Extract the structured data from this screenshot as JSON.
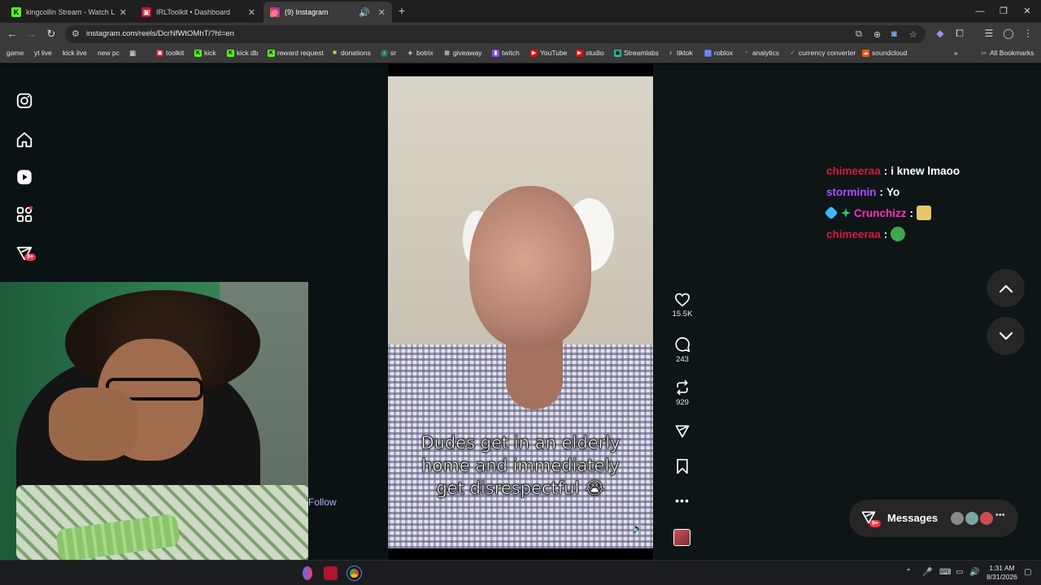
{
  "browser": {
    "tabs": [
      {
        "title": "kingcollin Stream - Watch Live",
        "active": false
      },
      {
        "title": "IRLToolkit • Dashboard",
        "active": false
      },
      {
        "title": "(9) Instagram",
        "active": true
      }
    ],
    "url": "instagram.com/reels/DcrNfWtOMhT/?hl=en",
    "bookmarks": [
      "game",
      "yt live",
      "kick live",
      "new pc",
      "toolkit",
      "kick",
      "kick db",
      "reward request",
      "donations",
      "sr",
      "botrix",
      "giveaway",
      "twitch",
      "YouTube",
      "studio",
      "Streamlabs",
      "tiktok",
      "roblox",
      "analytics",
      "currency converter",
      "soundcloud"
    ],
    "all_bookmarks": "All Bookmarks"
  },
  "sidebar": {
    "notifications_badge": "9+"
  },
  "reel": {
    "caption_line1": "Dudes get in an elderly",
    "caption_line2": "home and immediately",
    "caption_line3": "get disrespectful 😭",
    "likes": "15.5K",
    "comments": "243",
    "reposts": "929"
  },
  "chat": [
    {
      "user": "chimeeraa",
      "sep": " : ",
      "msg": "i knew lmaoo",
      "color": "#d61c3c"
    },
    {
      "user": "storminin",
      "sep": " : ",
      "msg": "Yo",
      "color": "#b14dff"
    },
    {
      "user": "Crunchizz",
      "sep": " : ",
      "msg": "",
      "color": "#ff2fc0"
    },
    {
      "user": "chimeeraa",
      "sep": " : ",
      "msg": "",
      "color": "#d61c3c"
    }
  ],
  "messages": {
    "label": "Messages",
    "badge": "9+"
  },
  "overlay": {
    "follow": "Follow"
  },
  "taskbar": {
    "time": "1:31 AM",
    "date": "8/31/2026"
  }
}
